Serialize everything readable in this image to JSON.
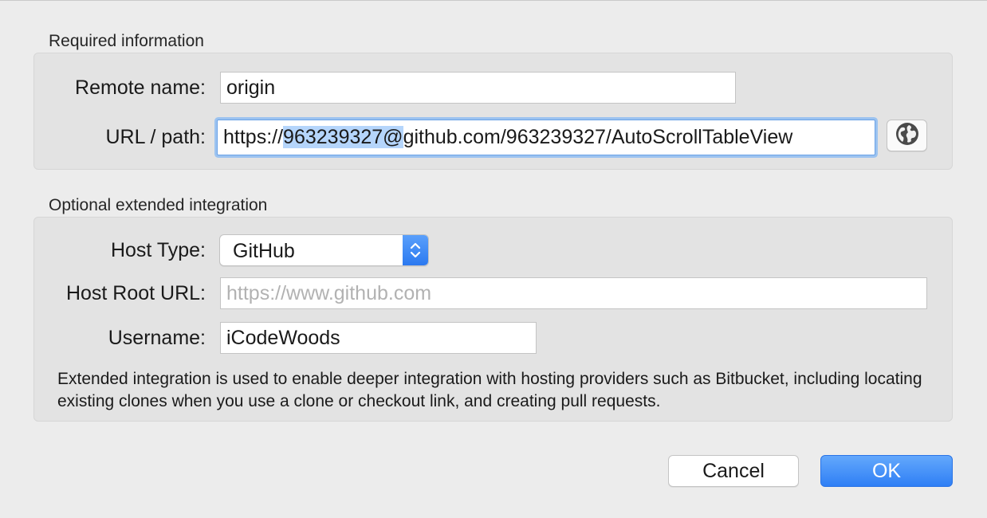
{
  "required": {
    "title": "Required information",
    "remote_name_label": "Remote name:",
    "remote_name_value": "origin",
    "url_label": "URL / path:",
    "url_prefix": "https://",
    "url_selected": "963239327@",
    "url_suffix": "github.com/963239327/AutoScrollTableView"
  },
  "optional": {
    "title": "Optional extended integration",
    "host_type_label": "Host Type:",
    "host_type_value": "GitHub",
    "host_root_label": "Host Root URL:",
    "host_root_placeholder": "https://www.github.com",
    "username_label": "Username:",
    "username_value": "iCodeWoods",
    "help_text": "Extended integration is used to enable deeper integration with hosting providers such as Bitbucket, including locating existing clones when you use a clone or checkout link, and creating pull requests."
  },
  "buttons": {
    "cancel": "Cancel",
    "ok": "OK"
  },
  "colors": {
    "accent": "#2f7ff5",
    "selection": "#b5d5fb",
    "focus_ring": "#9cc3f0"
  },
  "icons": {
    "browse": "globe-icon",
    "popup": "chevron-updown-icon"
  }
}
